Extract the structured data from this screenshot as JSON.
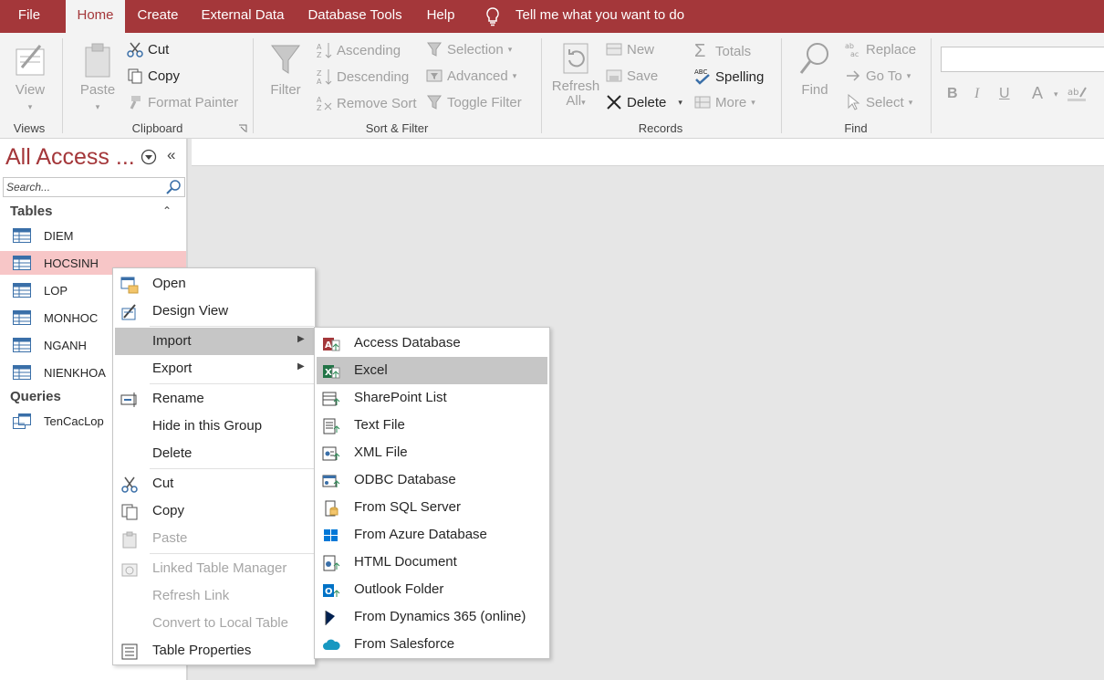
{
  "tabs": [
    "File",
    "Home",
    "Create",
    "External Data",
    "Database Tools",
    "Help"
  ],
  "tell_me": "Tell me what you want to do",
  "ribbon": {
    "views": {
      "view": "View",
      "group": "Views"
    },
    "clipboard": {
      "paste": "Paste",
      "cut": "Cut",
      "copy": "Copy",
      "format_painter": "Format Painter",
      "group": "Clipboard"
    },
    "sort_filter": {
      "filter": "Filter",
      "ascending": "Ascending",
      "descending": "Descending",
      "remove_sort": "Remove Sort",
      "selection": "Selection",
      "advanced": "Advanced",
      "toggle_filter": "Toggle Filter",
      "group": "Sort & Filter"
    },
    "records": {
      "refresh": "Refresh",
      "refresh_all": "All",
      "new": "New",
      "save": "Save",
      "delete": "Delete",
      "totals": "Totals",
      "spelling": "Spelling",
      "more": "More",
      "group": "Records"
    },
    "find": {
      "find": "Find",
      "replace": "Replace",
      "go_to": "Go To",
      "select": "Select",
      "group": "Find"
    },
    "text_format": {
      "bold": "B",
      "italic": "I",
      "underline": "U",
      "font_color": "A"
    }
  },
  "nav": {
    "title": "All Access ...",
    "search_placeholder": "Search...",
    "tables_header": "Tables",
    "tables": [
      "DIEM",
      "HOCSINH",
      "LOP",
      "MONHOC",
      "NGANH",
      "NIENKHOA"
    ],
    "selected_table": "HOCSINH",
    "queries_header": "Queries",
    "queries": [
      "TenCacLop"
    ]
  },
  "context_menu": {
    "open": "Open",
    "design_view": "Design View",
    "import": "Import",
    "export": "Export",
    "rename": "Rename",
    "hide_in_group": "Hide in this Group",
    "delete": "Delete",
    "cut": "Cut",
    "copy": "Copy",
    "paste": "Paste",
    "linked_table_manager": "Linked Table Manager",
    "refresh_link": "Refresh Link",
    "convert_to_local": "Convert to Local Table",
    "table_properties": "Table Properties"
  },
  "import_menu": {
    "items": [
      "Access Database",
      "Excel",
      "SharePoint List",
      "Text File",
      "XML File",
      "ODBC Database",
      "From SQL Server",
      "From Azure Database",
      "HTML Document",
      "Outlook Folder",
      "From Dynamics 365 (online)",
      "From Salesforce"
    ],
    "highlighted": "Excel"
  },
  "colors": {
    "accent": "#a4373a",
    "ribbon_bg": "#f3f3f3",
    "selected_row": "#f7c6c7",
    "menu_highlight": "#c6c6c6"
  }
}
